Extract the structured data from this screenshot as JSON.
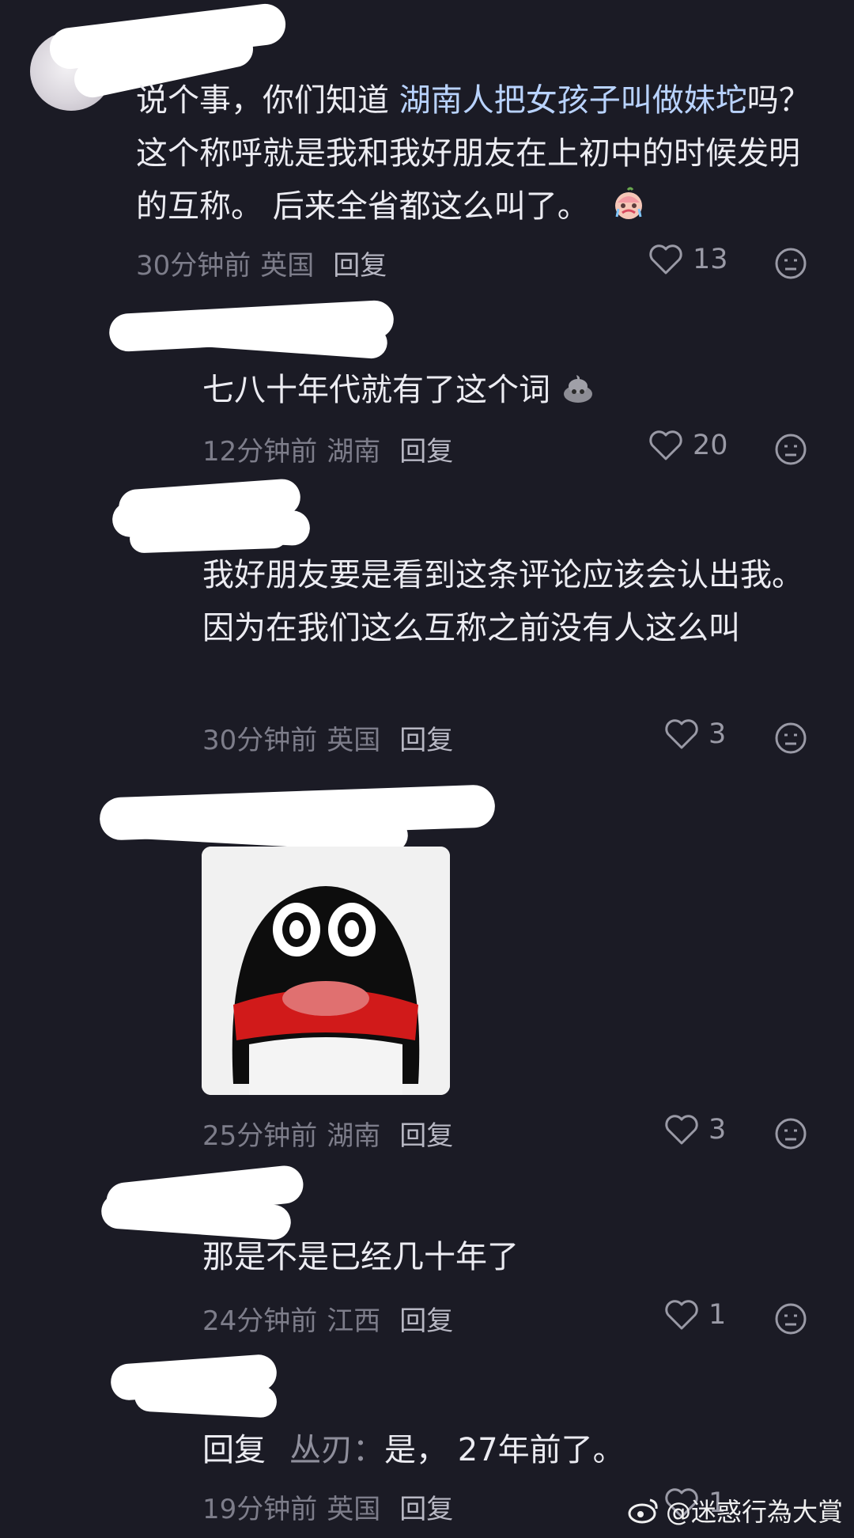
{
  "comments": [
    {
      "text_before": "说个事，你们知道 ",
      "text_highlight": "湖南人把女孩子叫做妹坨",
      "text_after": "吗？ 这个称呼就是我和我好朋友在上初中的时候发明的互称。 后来全省都这么叫了。",
      "time": "30分钟前",
      "location": "英国",
      "reply_label": "回复",
      "likes": "13"
    },
    {
      "text": "七八十年代就有了这个词",
      "time": "12分钟前",
      "location": "湖南",
      "reply_label": "回复",
      "likes": "20"
    },
    {
      "text": "我好朋友要是看到这条评论应该会认出我。因为在我们这么互称之前没有人这么叫",
      "time": "30分钟前",
      "location": "英国",
      "reply_label": "回复",
      "likes": "3"
    },
    {
      "time": "25分钟前",
      "location": "湖南",
      "reply_label": "回复",
      "likes": "3"
    },
    {
      "text": "那是不是已经几十年了",
      "time": "24分钟前",
      "location": "江西",
      "reply_label": "回复",
      "likes": "1"
    },
    {
      "reply_prefix": "回复",
      "reply_to": "丛刃：",
      "text": "是， 27年前了。",
      "time": "19分钟前",
      "location": "英国",
      "reply_label": "回复",
      "likes": "1"
    }
  ],
  "watermark": "@迷惑行為大賞",
  "colors": {
    "background": "#1b1b25",
    "highlight": "#b9d3ff",
    "meta": "#7d7d8a"
  }
}
